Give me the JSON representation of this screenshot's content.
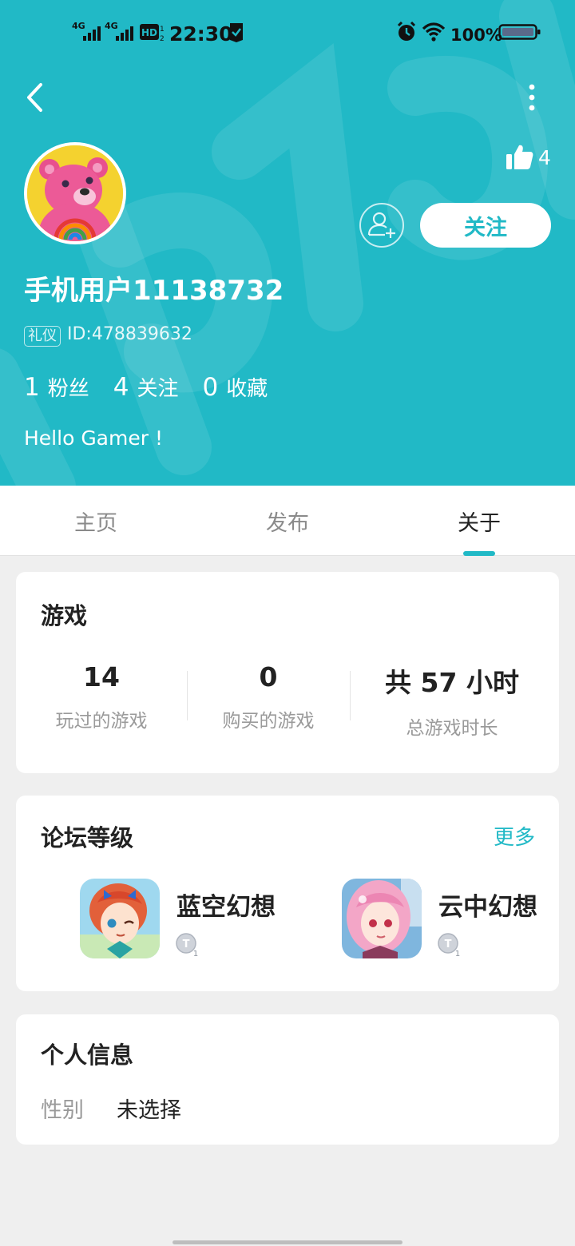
{
  "colors": {
    "accent": "#21b9c6",
    "page_bg": "#efefef"
  },
  "status_bar": {
    "signal_1": "4G",
    "signal_2": "4G",
    "hd_label": "HD",
    "time": "22:30",
    "battery": "100%",
    "icons": [
      "signal-icon",
      "hd-icon",
      "shield-check-icon",
      "alarm-icon",
      "wifi-icon",
      "battery-icon"
    ]
  },
  "header": {
    "like_count": "4",
    "follow_label": "关注",
    "username": "手机用户11138732",
    "badge": "礼仪",
    "user_id": "ID:478839632",
    "stats": [
      {
        "num": "1",
        "label": "粉丝"
      },
      {
        "num": "4",
        "label": "关注"
      },
      {
        "num": "0",
        "label": "收藏"
      }
    ],
    "bio": "Hello Gamer !"
  },
  "tabs": [
    {
      "label": "主页",
      "active": false
    },
    {
      "label": "发布",
      "active": false
    },
    {
      "label": "关于",
      "active": true
    }
  ],
  "games_card": {
    "title": "游戏",
    "stats": [
      {
        "value": "14",
        "label": "玩过的游戏"
      },
      {
        "value": "0",
        "label": "购买的游戏"
      },
      {
        "value": "共 57 小时",
        "label": "总游戏时长"
      }
    ]
  },
  "forum_card": {
    "title": "论坛等级",
    "more": "更多",
    "games": [
      {
        "name": "蓝空幻想",
        "level_mark": "T",
        "level": "1"
      },
      {
        "name": "云中幻想",
        "level_mark": "T",
        "level": "1"
      }
    ]
  },
  "info_card": {
    "title": "个人信息",
    "rows": [
      {
        "key": "性别",
        "value": "未选择"
      }
    ]
  }
}
